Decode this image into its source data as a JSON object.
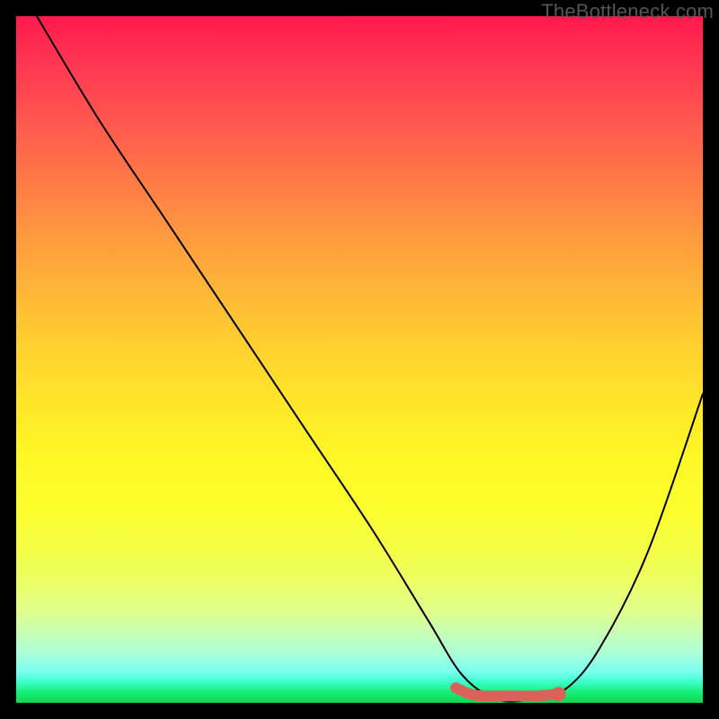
{
  "watermark": "TheBottleneck.com",
  "chart_data": {
    "type": "line",
    "title": "",
    "xlabel": "",
    "ylabel": "",
    "xlim": [
      0,
      100
    ],
    "ylim": [
      0,
      100
    ],
    "grid": false,
    "legend": false,
    "series": [
      {
        "name": "bottleneck-curve",
        "x": [
          3,
          12,
          22,
          32,
          42,
          52,
          60,
          65,
          70,
          75,
          80,
          85,
          92,
          100
        ],
        "y": [
          100,
          85,
          70,
          55,
          40,
          25,
          12,
          4,
          0.5,
          0.5,
          2,
          8,
          22,
          45
        ],
        "color": "#000000",
        "stroke_width": 2
      }
    ],
    "highlight": {
      "name": "optimal-range",
      "points": [
        {
          "x": 64,
          "y": 2.2
        },
        {
          "x": 66,
          "y": 1.3
        },
        {
          "x": 68,
          "y": 1.0
        },
        {
          "x": 72,
          "y": 1.0
        },
        {
          "x": 76,
          "y": 1.0
        },
        {
          "x": 79,
          "y": 1.3
        }
      ],
      "color": "#d9635a",
      "stroke_width": 12
    },
    "gradient_stops": [
      {
        "pos": 0.0,
        "color": "#ff1a4d"
      },
      {
        "pos": 0.5,
        "color": "#ffe52a"
      },
      {
        "pos": 0.85,
        "color": "#eaff6a"
      },
      {
        "pos": 1.0,
        "color": "#0cd94d"
      }
    ]
  }
}
